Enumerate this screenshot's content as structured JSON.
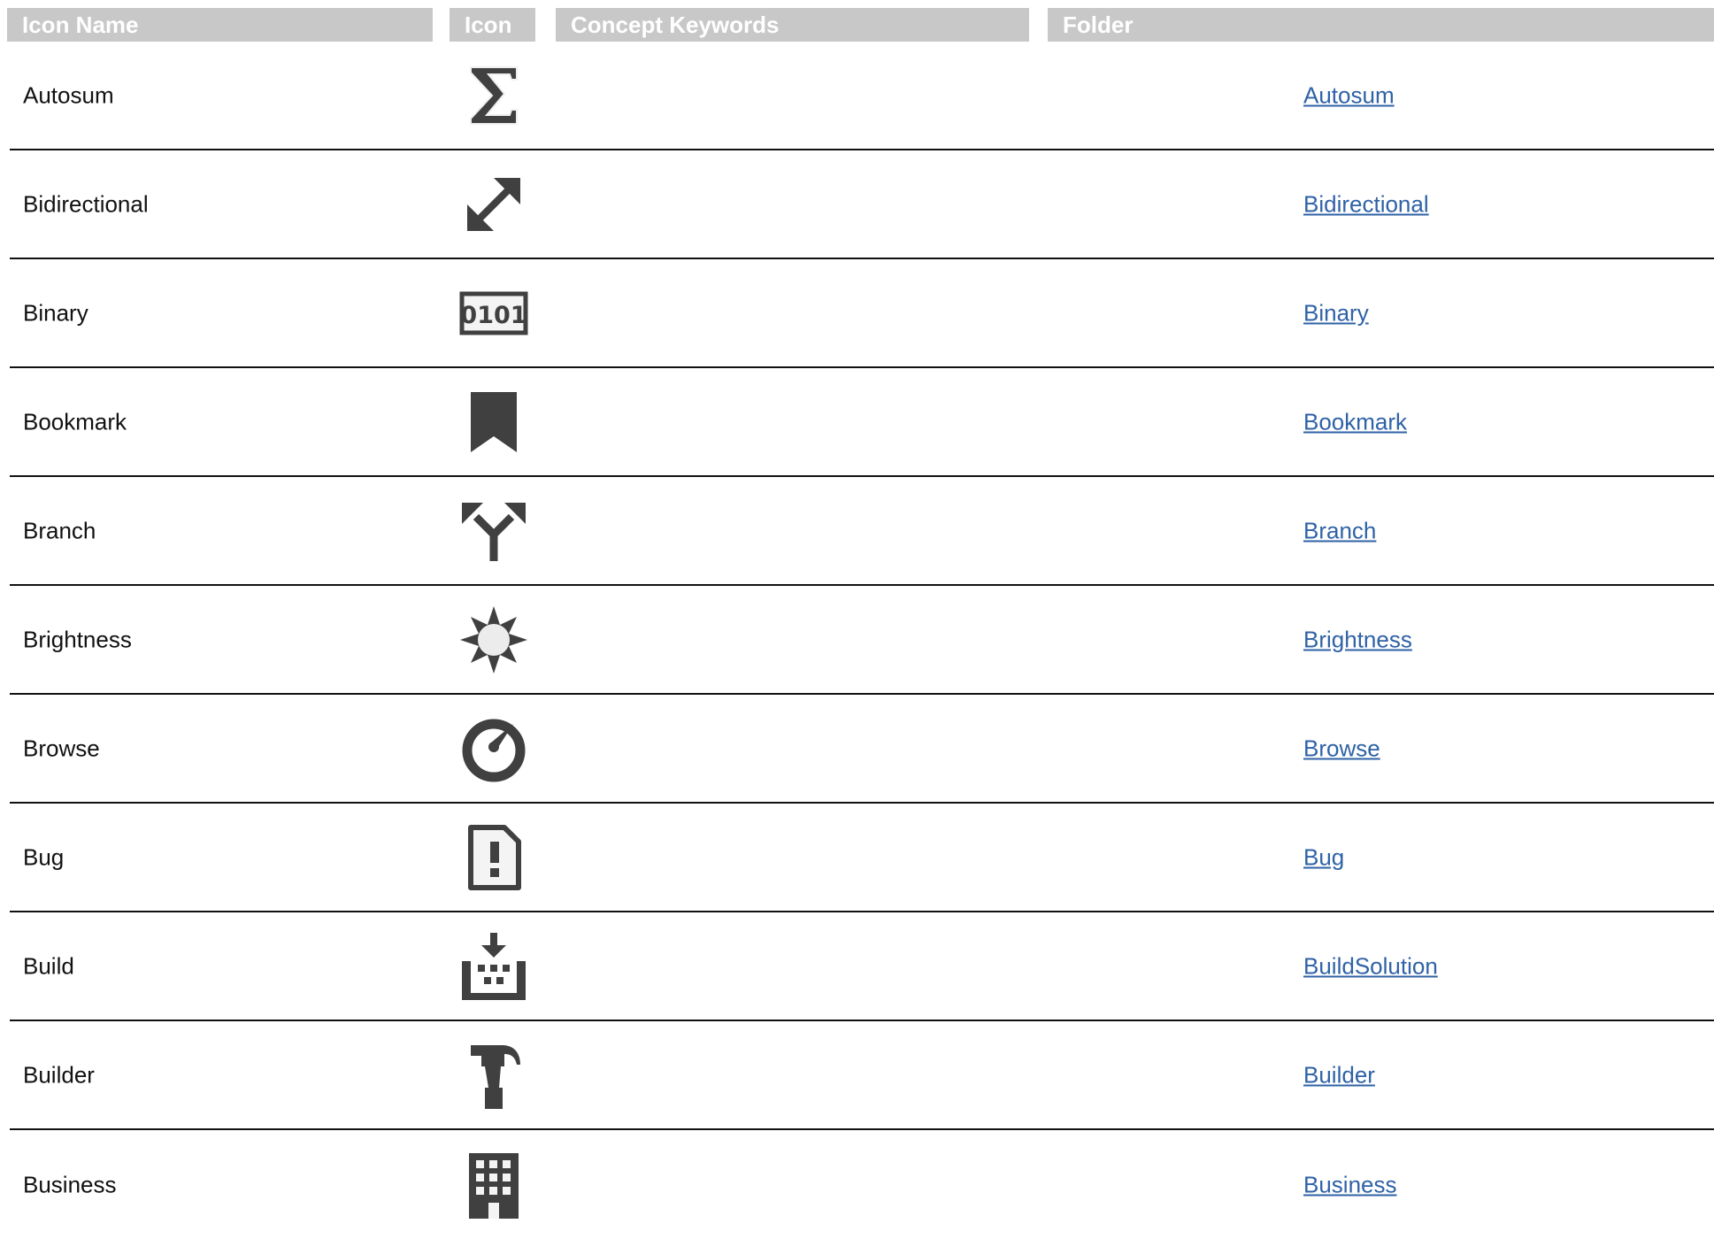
{
  "headers": {
    "name": "Icon Name",
    "icon": "Icon",
    "keywords": "Concept Keywords",
    "folder": "Folder"
  },
  "rows": [
    {
      "name": "Autosum",
      "icon": "autosum-icon",
      "keywords": "",
      "folder": "Autosum"
    },
    {
      "name": "Bidirectional",
      "icon": "bidirectional-icon",
      "keywords": "",
      "folder": "Bidirectional"
    },
    {
      "name": "Binary",
      "icon": "binary-icon",
      "keywords": "",
      "folder": "Binary"
    },
    {
      "name": "Bookmark",
      "icon": "bookmark-icon",
      "keywords": "",
      "folder": "Bookmark"
    },
    {
      "name": "Branch",
      "icon": "branch-icon",
      "keywords": "",
      "folder": "Branch"
    },
    {
      "name": "Brightness",
      "icon": "brightness-icon",
      "keywords": "",
      "folder": "Brightness"
    },
    {
      "name": "Browse",
      "icon": "browse-icon",
      "keywords": "",
      "folder": "Browse"
    },
    {
      "name": "Bug",
      "icon": "bug-icon",
      "keywords": "",
      "folder": "Bug"
    },
    {
      "name": "Build",
      "icon": "build-icon",
      "keywords": "",
      "folder": "BuildSolution"
    },
    {
      "name": "Builder",
      "icon": "builder-icon",
      "keywords": "",
      "folder": "Builder"
    },
    {
      "name": "Business",
      "icon": "business-icon",
      "keywords": "",
      "folder": "Business"
    }
  ],
  "colors": {
    "header_bg": "#c8c8c8",
    "icon_fill": "#404040",
    "link": "#2f62a6",
    "row_border": "#111111"
  }
}
